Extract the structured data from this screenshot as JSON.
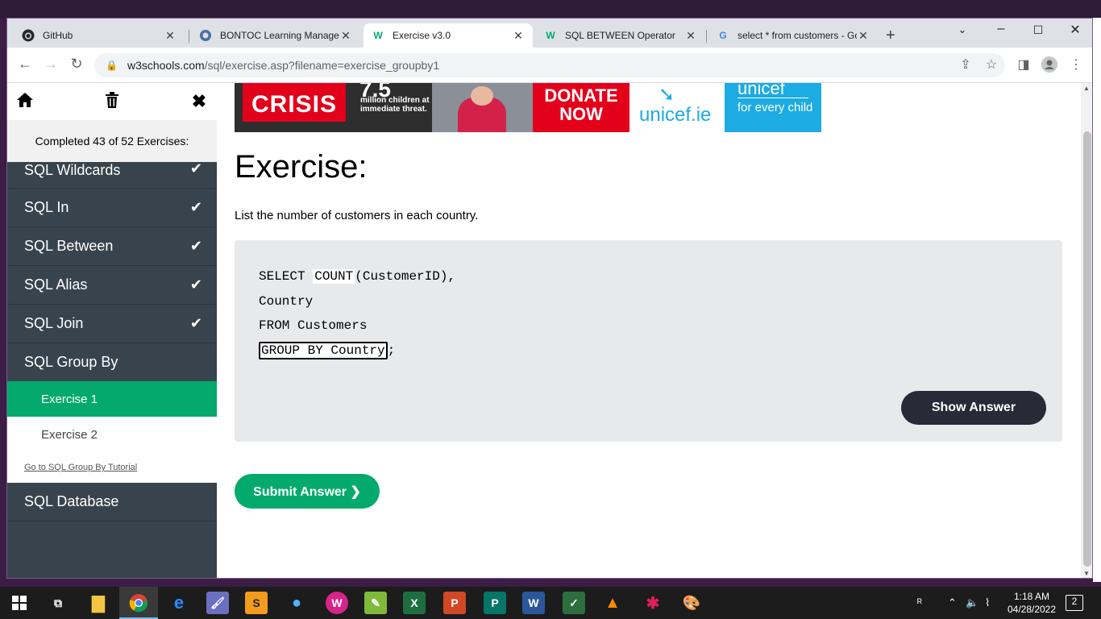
{
  "browser": {
    "tabs": [
      {
        "title": "GitHub",
        "favicon": "github-icon",
        "active": false
      },
      {
        "title": "BONTOC Learning Managem",
        "favicon": "moodle-icon",
        "active": false
      },
      {
        "title": "Exercise v3.0",
        "favicon": "w3schools-icon",
        "active": true
      },
      {
        "title": "SQL BETWEEN Operator",
        "favicon": "w3schools-icon",
        "active": false
      },
      {
        "title": "select * from customers - Go",
        "favicon": "google-icon",
        "active": false
      }
    ],
    "url_host": "w3schools.com",
    "url_path": "/sql/exercise.asp?filename=exercise_groupby1"
  },
  "sidebar": {
    "progress_text": "Completed 43 of 52 Exercises:",
    "items": [
      {
        "label": "SQL Wildcards",
        "done": true
      },
      {
        "label": "SQL In",
        "done": true
      },
      {
        "label": "SQL Between",
        "done": true
      },
      {
        "label": "SQL Alias",
        "done": true
      },
      {
        "label": "SQL Join",
        "done": true
      },
      {
        "label": "SQL Group By",
        "done": false
      }
    ],
    "sub_items": [
      {
        "label": "Exercise 1",
        "active": true
      },
      {
        "label": "Exercise 2",
        "active": false
      }
    ],
    "tutorial_link": "Go to SQL Group By Tutorial",
    "last_item": "SQL Database"
  },
  "banner": {
    "crisis": "CRISIS",
    "number": "7.5",
    "subtext": "million children at immediate threat.",
    "donate": "DONATE NOW",
    "unicef_site": "unicef.ie",
    "unicef_word": "unicef",
    "unicef_tagline": "for every child"
  },
  "exercise": {
    "title": "Exercise:",
    "description": "List the number of customers in each country.",
    "code": {
      "line1_pre": "SELECT ",
      "line1_hl": "COUNT",
      "line1_post": "(CustomerID),",
      "line2": "Country",
      "line3": "FROM Customers",
      "line4_box": "GROUP BY Country",
      "line4_post": ";"
    },
    "show_answer": "Show Answer",
    "submit": "Submit Answer ❯"
  },
  "taskbar": {
    "time": "1:18 AM",
    "date": "04/28/2022",
    "notifications": "2"
  },
  "colors": {
    "accent_green": "#04aa6d",
    "sidebar_bg": "#38444d",
    "dark_button": "#282a35"
  }
}
